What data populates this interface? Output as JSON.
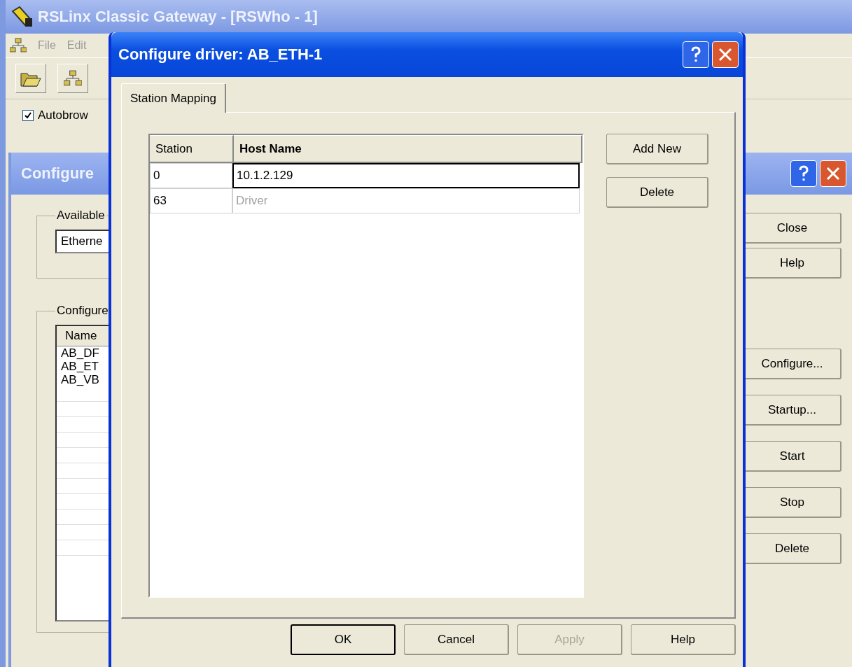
{
  "main_window": {
    "title": "RSLinx Classic Gateway - [RSWho - 1]",
    "menu": [
      "File",
      "Edit"
    ],
    "autobrowse": {
      "label": "Autobrow",
      "checked": true
    }
  },
  "drivers_dialog": {
    "title": "Configure",
    "available_group": {
      "label": "Available",
      "value": "Etherne"
    },
    "configured_group": {
      "label": "Configure",
      "columns": [
        "Name"
      ],
      "rows": [
        "AB_DF",
        "AB_ET",
        "AB_VB"
      ]
    },
    "buttons": [
      "Close",
      "Help",
      "Configure...",
      "Startup...",
      "Start",
      "Stop",
      "Delete"
    ]
  },
  "driver_dialog": {
    "title": "Configure driver: AB_ETH-1",
    "tabs": [
      {
        "label": "Station Mapping",
        "selected": true
      }
    ],
    "table": {
      "columns": [
        "Station",
        "Host Name"
      ],
      "rows": [
        {
          "station": "0",
          "host": "10.1.2.129",
          "editing": true,
          "disabled": false
        },
        {
          "station": "63",
          "host": "Driver",
          "editing": false,
          "disabled": true
        }
      ]
    },
    "side_buttons": [
      "Add New",
      "Delete"
    ],
    "buttons": [
      {
        "label": "OK",
        "default": true,
        "disabled": false
      },
      {
        "label": "Cancel",
        "default": false,
        "disabled": false
      },
      {
        "label": "Apply",
        "default": false,
        "disabled": true
      },
      {
        "label": "Help",
        "default": false,
        "disabled": false
      }
    ]
  }
}
